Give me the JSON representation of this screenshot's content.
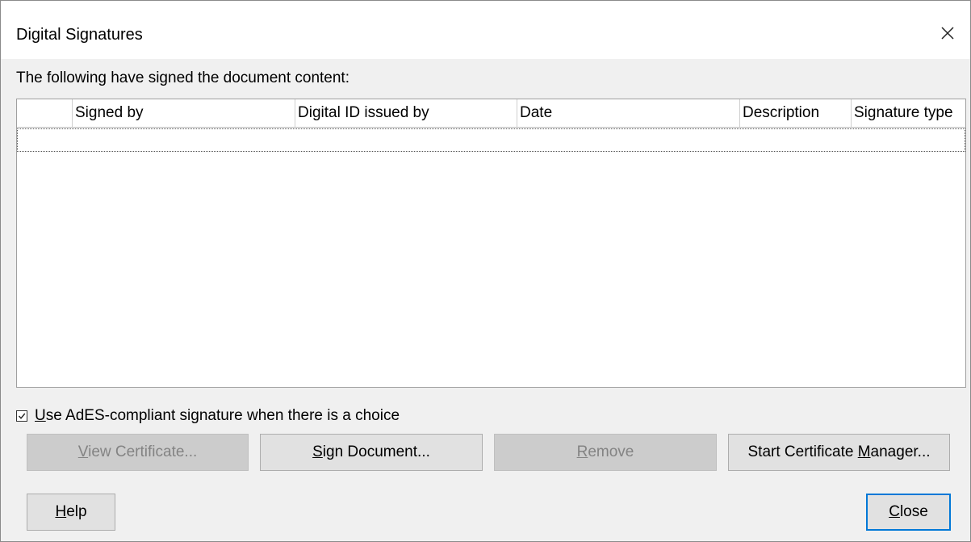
{
  "window": {
    "title": "Digital Signatures",
    "close_icon": "close-icon"
  },
  "intro_text": "The following have signed the document content:",
  "table": {
    "columns": [
      "",
      "Signed by",
      "Digital ID issued by",
      "Date",
      "Description",
      "Signature type"
    ],
    "rows": []
  },
  "ades_checkbox": {
    "label_underlined": "U",
    "label_rest": "se AdES-compliant signature when there is a choice",
    "checked": true
  },
  "buttons": {
    "view_certificate": {
      "u": "V",
      "rest": "iew Certificate...",
      "enabled": false
    },
    "sign_document": {
      "u": "S",
      "rest": "ign Document...",
      "enabled": true
    },
    "remove": {
      "u": "R",
      "rest": "emove",
      "enabled": false
    },
    "start_cert_manager": {
      "pre": "Start Certificate ",
      "u": "M",
      "rest": "anager...",
      "enabled": true
    },
    "help": {
      "u": "H",
      "rest": "elp"
    },
    "close": {
      "u": "C",
      "rest": "lose"
    }
  },
  "colors": {
    "accent_focus": "#0078d7",
    "dialog_bg": "#f0f0f0",
    "button_bg": "#e1e1e1",
    "disabled_button_bg": "#cccccc",
    "disabled_text": "#838383"
  }
}
